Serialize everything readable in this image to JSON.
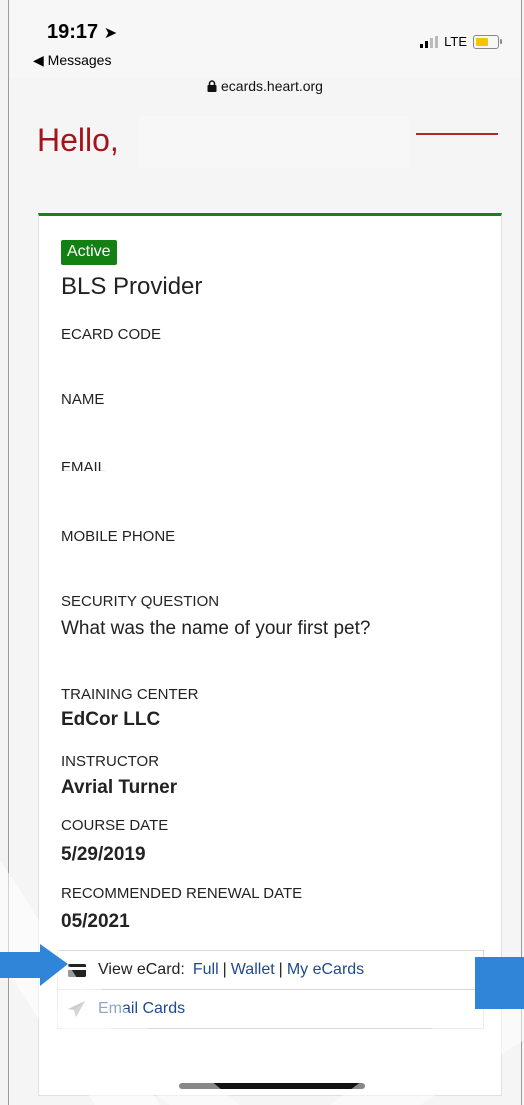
{
  "status_bar": {
    "time": "19:17",
    "location_arrow": "⊲",
    "back_label": "◀ Messages",
    "network": "LTE",
    "url": "ecards.heart.org"
  },
  "header": {
    "greeting": "Hello,"
  },
  "card": {
    "status_badge": "Active",
    "course_title": "BLS Provider",
    "fields": {
      "ecard_code_label": "ECARD CODE",
      "name_label": "NAME",
      "email_label": "EMAIL",
      "mobile_label": "MOBILE PHONE",
      "security_question_label": "SECURITY QUESTION",
      "security_question_value": "What was the name of your first pet?",
      "training_center_label": "TRAINING CENTER",
      "training_center_value": "EdCor LLC",
      "instructor_label": "INSTRUCTOR",
      "instructor_value": "Avrial Turner",
      "course_date_label": "COURSE DATE",
      "course_date_value": "5/29/2019",
      "renewal_label": "RECOMMENDED RENEWAL DATE",
      "renewal_value": "05/2021"
    },
    "actions": {
      "view_ecard_label": "View eCard:",
      "full_link": "Full",
      "wallet_link": "Wallet",
      "my_ecards_link": "My eCards",
      "separator": "|",
      "email_cards_link": "Email Cards"
    }
  },
  "colors": {
    "brand_red": "#a3151b",
    "active_green": "#128012",
    "link_blue": "#1e4b8f",
    "annotation_blue": "#2f86d8"
  },
  "icons": {
    "card": "credit-card-icon",
    "send": "paper-plane-icon",
    "lock": "lock-icon"
  }
}
